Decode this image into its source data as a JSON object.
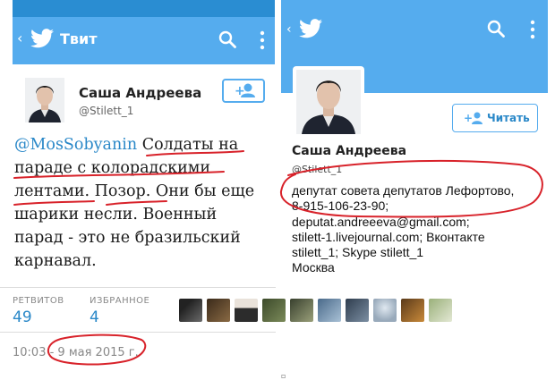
{
  "left_panel": {
    "title": "Твит",
    "back_glyph": "‹",
    "author": {
      "name": "Саша Андреева",
      "handle": "@Stilett_1"
    },
    "tweet": {
      "mention": "@MosSobyanin",
      "lines_rest": [
        " Солдаты на",
        "параде с колорадскими",
        "лентами. Позор. Они бы еще",
        "шарики несли. Военный",
        "парад - это не бразильский",
        "карнавал."
      ]
    },
    "stats": {
      "retweets_label": "РЕТВИТОВ",
      "retweets_value": "49",
      "favorites_label": "ИЗБРАННОЕ",
      "favorites_value": "4"
    },
    "timestamp": "10:03 - 9 мая 2015 г.",
    "favoriter_icons": [
      "wolf-avatar",
      "bear-avatar",
      "man-in-suit-avatar",
      "helicopter-avatar",
      "soldiers-avatar",
      "landscape-avatar",
      "dark-avatar",
      "cartoon-avatar",
      "tank-avatar",
      "seal-avatar"
    ]
  },
  "right_panel": {
    "back_glyph": "‹",
    "follow_label": "Читать",
    "author": {
      "name": "Саша Андреева",
      "handle": "@Stilett_1"
    },
    "bio_lines": [
      "депутат совета депутатов Лефортово,",
      "8-915-106-23-90;",
      "deputat.andreeeva@gmail.com;",
      "stilett-1.livejournal.com; Вконтакте",
      "stilett_1; Skype stilett_1",
      "Москва"
    ]
  },
  "colors": {
    "twitter_blue": "#55acee",
    "link_blue": "#2a88c8",
    "annotation_red": "#d8222a"
  }
}
